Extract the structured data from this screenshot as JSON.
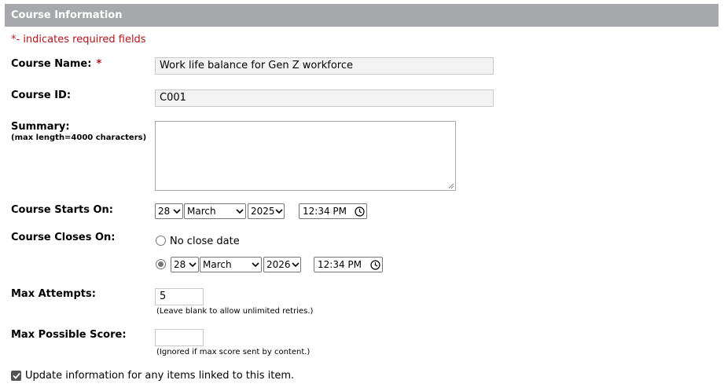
{
  "header": {
    "title": "Course Information"
  },
  "required_note": "*- indicates required fields",
  "course_name": {
    "label": "Course Name:",
    "required_mark": "*",
    "value": "Work life balance for Gen Z workforce"
  },
  "course_id": {
    "label": "Course ID:",
    "value": "C001"
  },
  "summary": {
    "label": "Summary:",
    "sublabel": "(max length=4000 characters)",
    "value": ""
  },
  "starts_on": {
    "label": "Course Starts On:",
    "day": "28",
    "month": "March",
    "year": "2025",
    "time": "12:34 PM"
  },
  "closes_on": {
    "label": "Course Closes On:",
    "no_close_label": "No close date",
    "no_close_selected": false,
    "date_selected": true,
    "day": "28",
    "month": "March",
    "year": "2026",
    "time": "12:34 PM"
  },
  "max_attempts": {
    "label": "Max Attempts:",
    "value": "5",
    "hint": "(Leave blank to allow unlimited retries.)"
  },
  "max_score": {
    "label": "Max Possible Score:",
    "value": "",
    "hint": "(Ignored if max score sent by content.)"
  },
  "update_linked": {
    "label": "Update information for any items linked to this item.",
    "checked": true
  },
  "icons": {
    "dropdown": "chevron-down-icon",
    "clock": "clock-icon",
    "check": "check-icon"
  },
  "colors": {
    "header_bg": "#a6a8ab",
    "required": "#b2141a"
  }
}
